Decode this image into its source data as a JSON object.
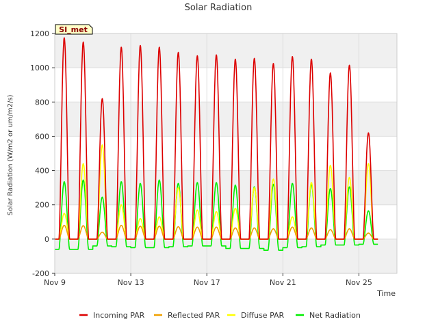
{
  "chart_data": {
    "type": "line",
    "title": "Solar Radiation",
    "xlabel": "Time",
    "ylabel": "Solar Radiation (W/m2 or um/m2/s)",
    "site_tag": "SI_met",
    "xlim": [
      9,
      27
    ],
    "ylim": [
      -200,
      1200
    ],
    "x_ticks": [
      {
        "value": 9,
        "label": "Nov 9"
      },
      {
        "value": 13,
        "label": "Nov 13"
      },
      {
        "value": 17,
        "label": "Nov 17"
      },
      {
        "value": 21,
        "label": "Nov 21"
      },
      {
        "value": 25,
        "label": "Nov 25"
      }
    ],
    "y_ticks": [
      -200,
      0,
      200,
      400,
      600,
      800,
      1000,
      1200
    ],
    "grid": true,
    "legend_position": "bottom",
    "series": [
      {
        "name": "Incoming PAR",
        "color": "#dd0000",
        "x": [
          9.5,
          10.5,
          11.5,
          12.5,
          13.5,
          14.5,
          15.5,
          16.5,
          17.5,
          18.5,
          19.5,
          20.5,
          21.5,
          22.5,
          23.5,
          24.5,
          25.5
        ],
        "daily_peak": [
          1175,
          1150,
          820,
          1120,
          1130,
          1120,
          1090,
          1070,
          1075,
          1050,
          1055,
          1025,
          1065,
          1050,
          970,
          1015,
          620
        ]
      },
      {
        "name": "Reflected PAR",
        "color": "#f0a000",
        "x": [
          9.5,
          10.5,
          11.5,
          12.5,
          13.5,
          14.5,
          15.5,
          16.5,
          17.5,
          18.5,
          19.5,
          20.5,
          21.5,
          22.5,
          23.5,
          24.5,
          25.5
        ],
        "daily_peak": [
          80,
          78,
          40,
          80,
          75,
          75,
          72,
          70,
          70,
          65,
          65,
          60,
          70,
          65,
          55,
          60,
          35
        ]
      },
      {
        "name": "Diffuse PAR",
        "color": "#ffff00",
        "x": [
          9.5,
          10.5,
          11.5,
          12.5,
          13.5,
          14.5,
          15.5,
          16.5,
          17.5,
          18.5,
          19.5,
          20.5,
          21.5,
          22.5,
          23.5,
          24.5,
          25.5
        ],
        "daily_peak": [
          150,
          440,
          550,
          200,
          120,
          130,
          300,
          170,
          160,
          180,
          300,
          350,
          130,
          330,
          430,
          360,
          440
        ]
      },
      {
        "name": "Net Radiation",
        "color": "#00ee00",
        "x": [
          9.5,
          10.5,
          11.5,
          12.5,
          13.5,
          14.5,
          15.5,
          16.5,
          17.5,
          18.5,
          19.5,
          20.5,
          21.5,
          22.5,
          23.5,
          24.5,
          25.5
        ],
        "daily_peak": [
          335,
          345,
          245,
          335,
          325,
          345,
          325,
          330,
          330,
          315,
          305,
          320,
          325,
          320,
          295,
          305,
          165
        ],
        "night_value": [
          -60,
          -60,
          -40,
          -45,
          -50,
          -50,
          -45,
          -40,
          -40,
          -55,
          -55,
          -65,
          -50,
          -45,
          -35,
          -35,
          -30
        ]
      }
    ]
  }
}
